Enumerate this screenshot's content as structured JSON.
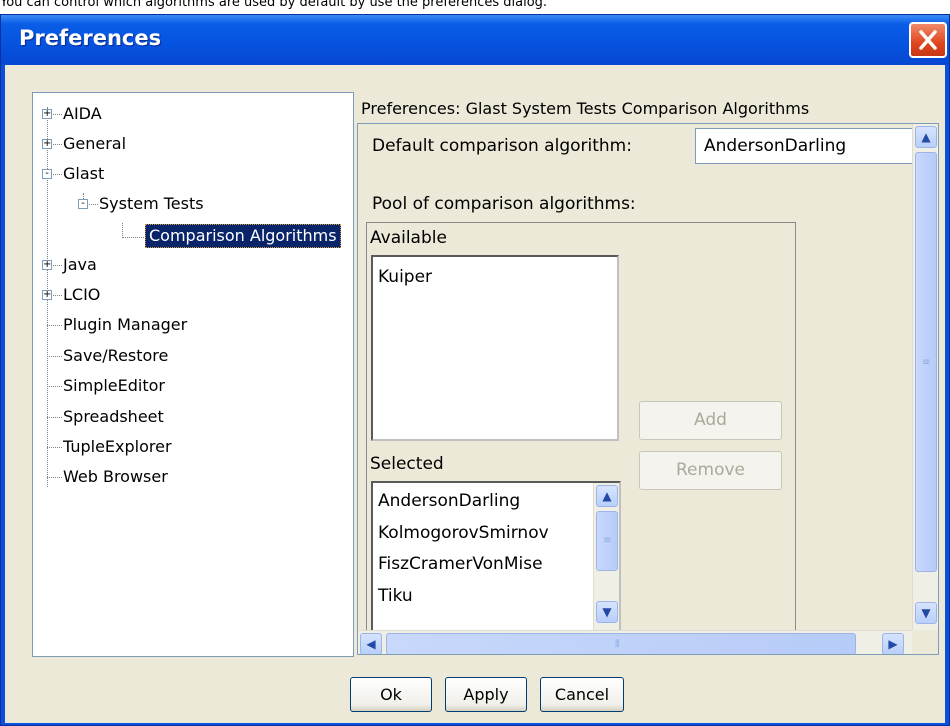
{
  "caption": "You can control which algorithms are used by default by use the preferences dialog.",
  "window": {
    "title": "Preferences"
  },
  "tree": {
    "items": [
      {
        "label": "AIDA",
        "toggle": "+"
      },
      {
        "label": "General",
        "toggle": "+"
      },
      {
        "label": "Glast",
        "toggle": "-"
      },
      {
        "label": "System Tests",
        "toggle": "-"
      },
      {
        "label": "Comparison Algorithms",
        "toggle": ""
      },
      {
        "label": "Java",
        "toggle": "+"
      },
      {
        "label": "LCIO",
        "toggle": "+"
      },
      {
        "label": "Plugin Manager",
        "toggle": ""
      },
      {
        "label": "Save/Restore",
        "toggle": ""
      },
      {
        "label": "SimpleEditor",
        "toggle": ""
      },
      {
        "label": "Spreadsheet",
        "toggle": ""
      },
      {
        "label": "TupleExplorer",
        "toggle": ""
      },
      {
        "label": "Web Browser",
        "toggle": ""
      }
    ]
  },
  "panel": {
    "heading": "Preferences: Glast System Tests Comparison Algorithms",
    "default_label": "Default comparison algorithm:",
    "default_value": "AndersonDarling",
    "pool_label": "Pool of comparison algorithms:",
    "available_label": "Available",
    "available_items": [
      "Kuiper"
    ],
    "selected_label": "Selected",
    "selected_items": [
      "AndersonDarling",
      "KolmogorovSmirnov",
      "FiszCramerVonMise",
      "Tiku"
    ],
    "add_label": "Add",
    "remove_label": "Remove"
  },
  "buttons": {
    "ok": "Ok",
    "apply": "Apply",
    "cancel": "Cancel"
  },
  "colors": {
    "titlebar": "#0654e0",
    "selection": "#0a246a",
    "dialog_bg": "#ece9d8"
  }
}
